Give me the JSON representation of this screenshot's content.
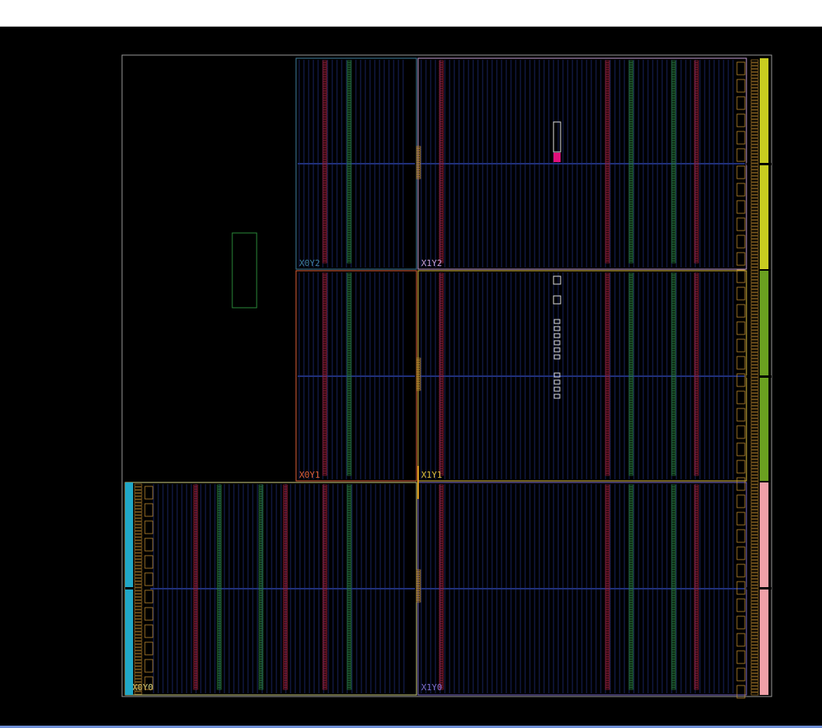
{
  "device_view": {
    "clock_regions": [
      {
        "name": "X0Y2",
        "color": "#3f7fa0"
      },
      {
        "name": "X1Y2",
        "color": "#c8a0d8"
      },
      {
        "name": "X0Y1",
        "color": "#e0603a"
      },
      {
        "name": "X1Y1",
        "color": "#e0c040"
      },
      {
        "name": "X0Y0",
        "color": "#d0d080"
      },
      {
        "name": "X1Y0",
        "color": "#8070d0"
      }
    ],
    "io_bank_colors": {
      "right_top": "#c8cc20",
      "right_mid": "#6aa020",
      "right_bot": "#f0a0a8",
      "left_bot": "#20a8c8"
    },
    "column_colors": {
      "bram": "#a0203a",
      "dsp": "#2a8040",
      "clb": "#1a2a6a",
      "io": "#c08a30"
    },
    "pblock_color": "#2a8a3a",
    "marker_color": "#e0107a"
  }
}
